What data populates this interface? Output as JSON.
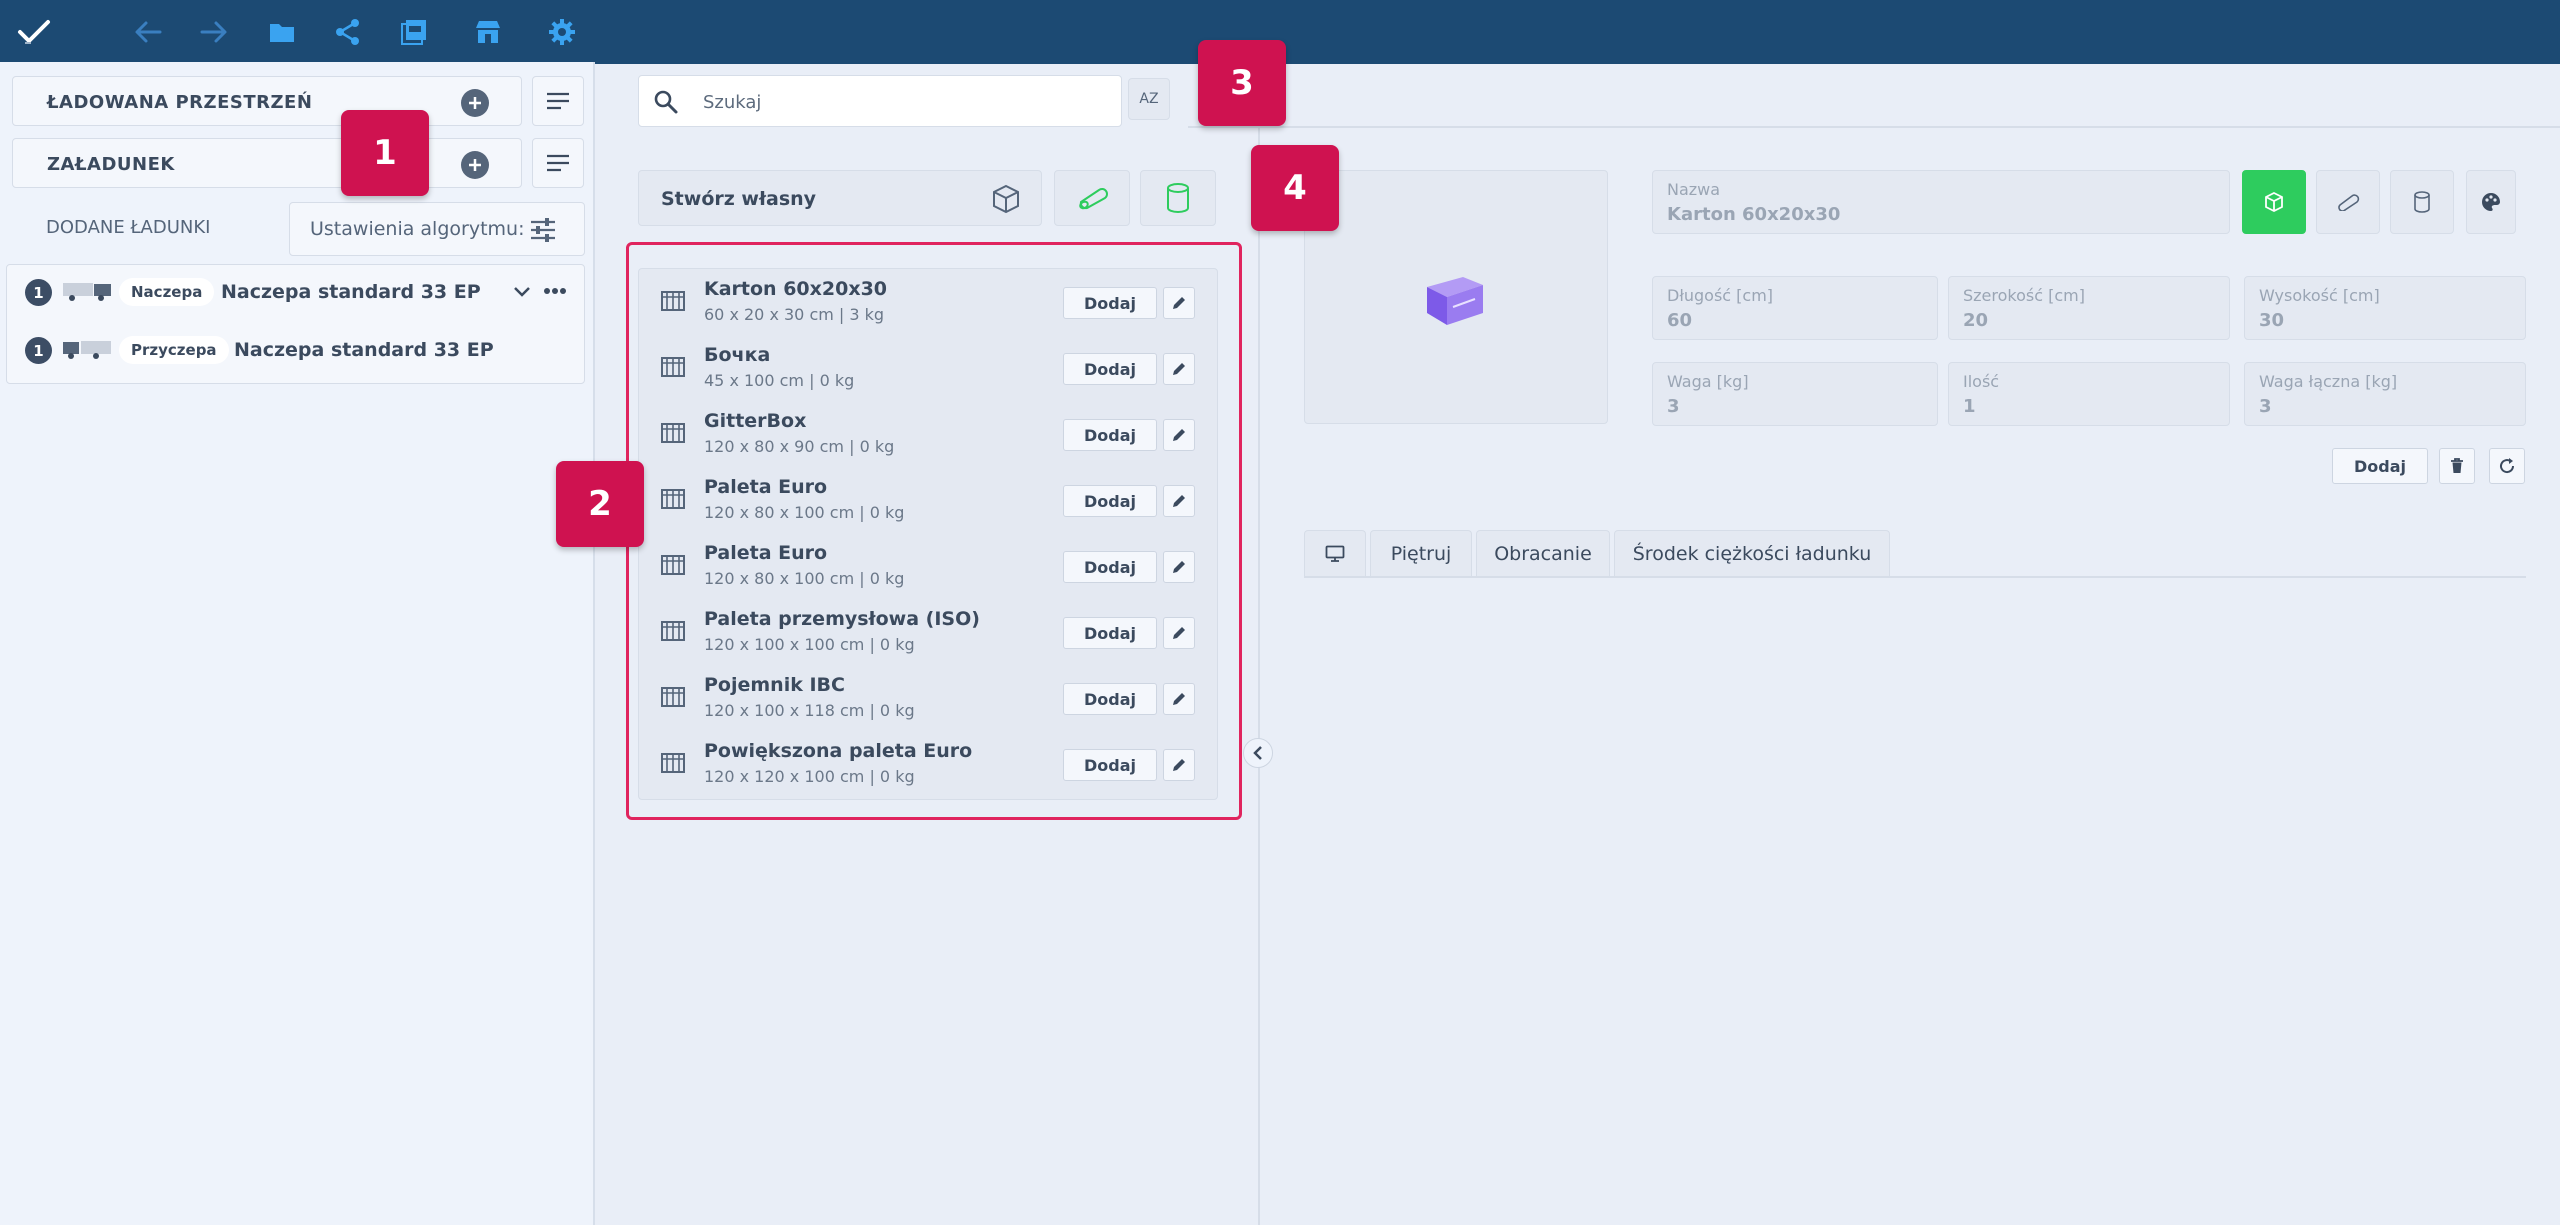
{
  "toolbar": {
    "icons": [
      "checkmark-icon",
      "undo-arrow-icon",
      "redo-arrow-icon",
      "folder-icon",
      "share-icon",
      "pdf-icon",
      "store-icon",
      "gear-icon"
    ],
    "accent_color": "#3aa3f0",
    "bar_color": "#1c4a73"
  },
  "left": {
    "space_title": "ŁADOWANA PRZESTRZEŃ",
    "cargo_title": "ZAŁADUNEK",
    "added_label": "DODANE ŁADUNKI",
    "algo_label": "Ustawienia algorytmu:",
    "loads": [
      {
        "count": "1",
        "type": "Naczepa",
        "name": "Naczepa standard 33 EP"
      },
      {
        "count": "1",
        "type": "Przyczepa",
        "name": "Naczepa standard 33 EP"
      }
    ]
  },
  "middle": {
    "search_placeholder": "Szukaj",
    "sort_label": "AZ",
    "create_label": "Stwórz własny",
    "items": [
      {
        "name": "Karton 60x20x30",
        "dims": "60 x 20 x 30 cm | 3 kg",
        "add": "Dodaj"
      },
      {
        "name": "Бочка",
        "dims": "45 x 100 cm | 0 kg",
        "add": "Dodaj"
      },
      {
        "name": "GitterBox",
        "dims": "120 x 80 x 90 cm | 0 kg",
        "add": "Dodaj"
      },
      {
        "name": "Paleta Euro",
        "dims": "120 x 80 x 100 cm | 0 kg",
        "add": "Dodaj"
      },
      {
        "name": "Paleta Euro",
        "dims": "120 x 80 x 100 cm | 0 kg",
        "add": "Dodaj"
      },
      {
        "name": "Paleta przemysłowa (ISO)",
        "dims": "120 x 100 x 100 cm | 0 kg",
        "add": "Dodaj"
      },
      {
        "name": "Pojemnik IBC",
        "dims": "120 x 100 x 118 cm | 0 kg",
        "add": "Dodaj"
      },
      {
        "name": "Powiększona paleta Euro",
        "dims": "120 x 120 x 100 cm | 0 kg",
        "add": "Dodaj"
      }
    ]
  },
  "right": {
    "name_label": "Nazwa",
    "name_value": "Karton 60x20x30",
    "length_label": "Długość [cm]",
    "length_value": "60",
    "width_label": "Szerokość [cm]",
    "width_value": "20",
    "height_label": "Wysokość [cm]",
    "height_value": "30",
    "weight_label": "Waga [kg]",
    "weight_value": "3",
    "qty_label": "Ilość",
    "qty_value": "1",
    "total_weight_label": "Waga łączna [kg]",
    "total_weight_value": "3",
    "add_label": "Dodaj",
    "active_color": "#2ecc5e",
    "tabs": [
      "Piętruj",
      "Obracanie",
      "Środek ciężkości ładunku"
    ]
  },
  "callouts": [
    "1",
    "2",
    "3",
    "4"
  ],
  "callout_color": "#cf1250"
}
